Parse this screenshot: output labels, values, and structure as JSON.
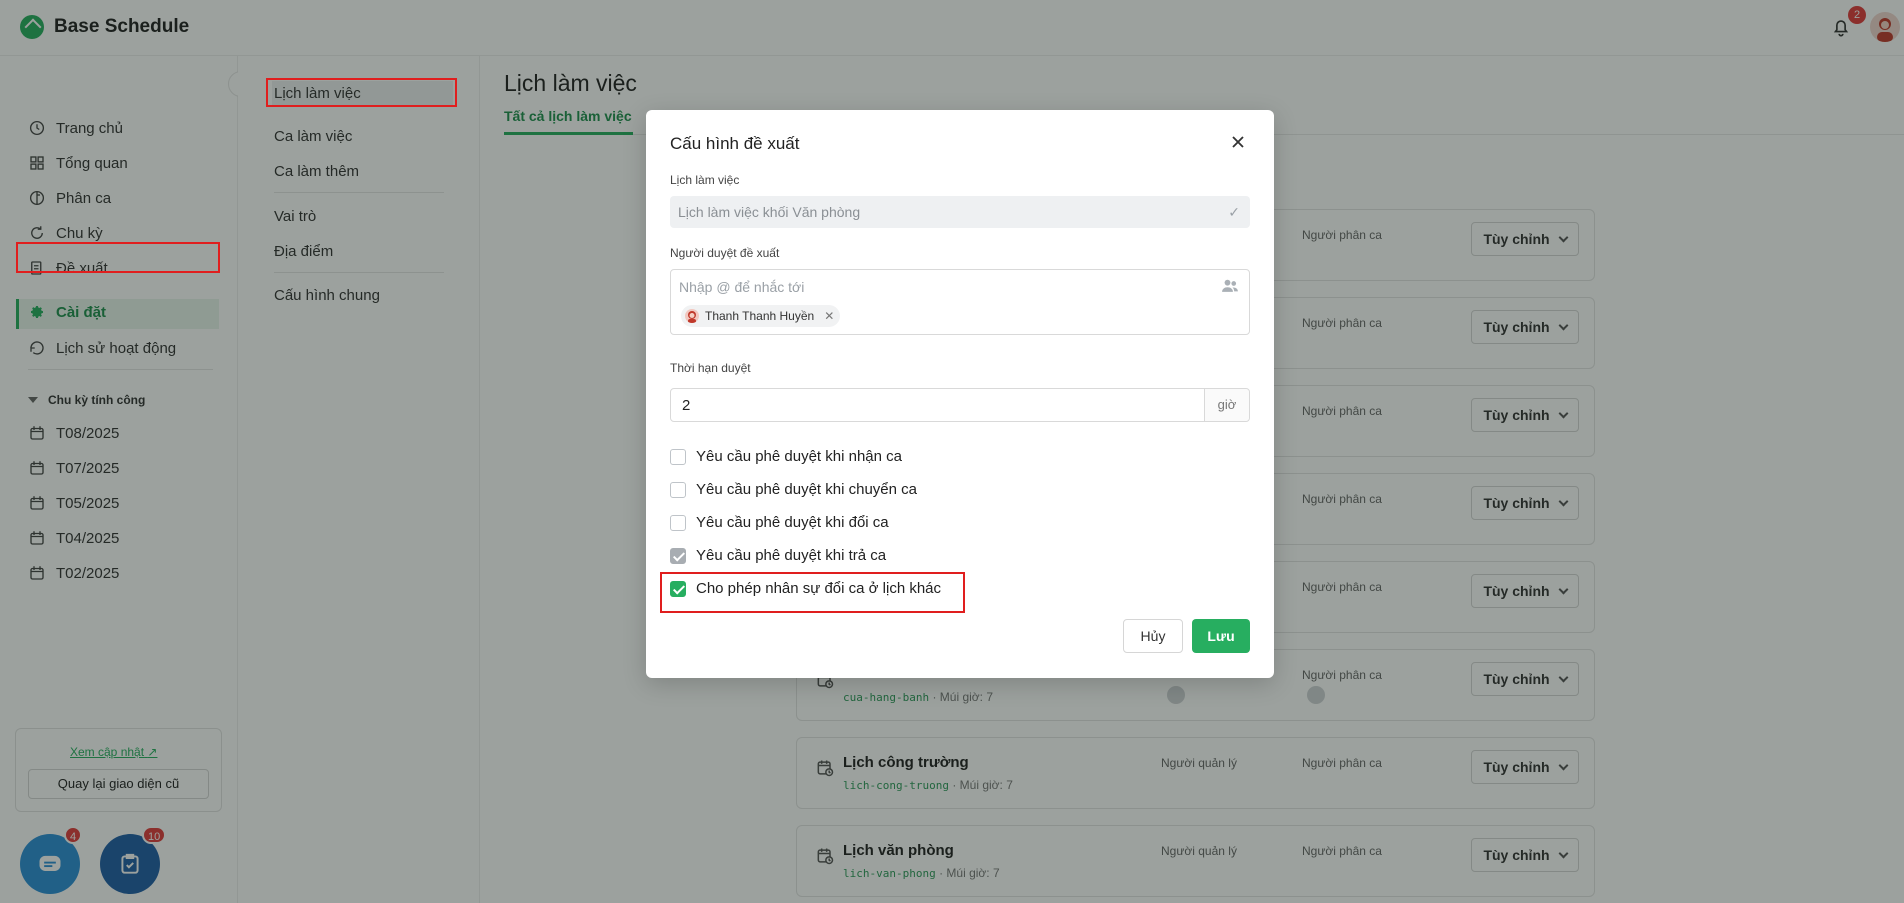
{
  "app": {
    "name": "Base Schedule",
    "notification_count": "2"
  },
  "sidebar": {
    "items": [
      {
        "label": "Trang chủ",
        "icon": "clock-icon"
      },
      {
        "label": "Tổng quan",
        "icon": "grid-icon"
      },
      {
        "label": "Phân ca",
        "icon": "shift-icon"
      },
      {
        "label": "Chu kỳ",
        "icon": "cycle-icon"
      },
      {
        "label": "Đề xuất",
        "icon": "proposal-icon"
      },
      {
        "label": "Cài đặt",
        "icon": "gear-icon",
        "active": true
      },
      {
        "label": "Lịch sử hoạt động",
        "icon": "history-icon"
      }
    ],
    "section_title": "Chu kỳ tính công",
    "periods": [
      "T08/2025",
      "T07/2025",
      "T05/2025",
      "T04/2025",
      "T02/2025"
    ],
    "update_link": "Xem cập nhật",
    "old_ui_button": "Quay lại giao diện cũ",
    "chat_badge": "4",
    "tasks_badge": "10"
  },
  "subnav": {
    "items": [
      "Lịch làm việc",
      "Ca làm việc",
      "Ca làm thêm",
      "Vai trò",
      "Địa điểm",
      "Cấu hình chung"
    ],
    "active": "Lịch làm việc"
  },
  "main": {
    "title": "Lịch làm việc",
    "tab_all": "Tất cả lịch làm việc",
    "customize_label": "Tùy chỉnh",
    "role_manager": "Người quản lý",
    "role_assigner": "Người phân ca",
    "cards": [
      {
        "title": "",
        "code": "",
        "timezone": ""
      },
      {
        "title": "",
        "code": "",
        "timezone": ""
      },
      {
        "title": "",
        "code": "",
        "timezone": ""
      },
      {
        "title": "",
        "code": "",
        "timezone": ""
      },
      {
        "title": "",
        "code": "",
        "timezone": ""
      },
      {
        "title": "",
        "code": "cua-hang-banh",
        "timezone": "· Múi giờ: 7"
      },
      {
        "title": "Lịch công trường",
        "code": "lich-cong-truong",
        "timezone": "· Múi giờ: 7"
      },
      {
        "title": "Lịch văn phòng",
        "code": "lich-van-phong",
        "timezone": "· Múi giờ: 7"
      }
    ]
  },
  "modal": {
    "title": "Cấu hình đề xuất",
    "schedule_label": "Lịch làm việc",
    "schedule_value": "Lịch làm việc khối Văn phòng",
    "approver_label": "Người duyệt đề xuất",
    "approver_placeholder": "Nhập @ để nhắc tới",
    "approver_chip": "Thanh Thanh Huyền",
    "deadline_label": "Thời hạn duyệt",
    "deadline_value": "2",
    "deadline_unit": "giờ",
    "checkboxes": [
      {
        "label": "Yêu cầu phê duyệt khi nhận ca",
        "checked": false
      },
      {
        "label": "Yêu cầu phê duyệt khi chuyển ca",
        "checked": false
      },
      {
        "label": "Yêu cầu phê duyệt khi đổi ca",
        "checked": false
      },
      {
        "label": "Yêu cầu phê duyệt khi trả ca",
        "checked": true,
        "disabled": true
      },
      {
        "label": "Cho phép nhân sự đổi ca ở lịch khác",
        "checked": true
      }
    ],
    "cancel_label": "Hủy",
    "save_label": "Lưu"
  },
  "colors": {
    "brand": "#27ae60",
    "highlight": "#e01e1e",
    "badge": "#e23b3b",
    "chat_fab": "#2b8fd8",
    "tasks_fab": "#1f5fa8"
  }
}
